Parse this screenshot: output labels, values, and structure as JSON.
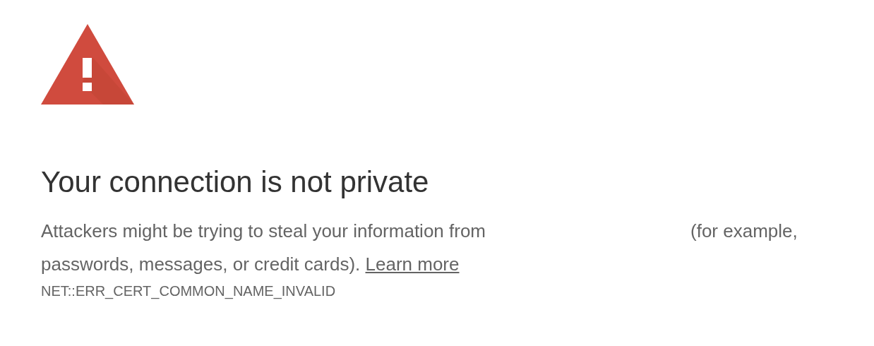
{
  "heading": "Your connection is not private",
  "message": {
    "before_gap": "Attackers might be trying to steal your information from",
    "after_gap": "(for example, passwords, messages, or credit cards).",
    "link": "Learn more"
  },
  "error_code": "NET::ERR_CERT_COMMON_NAME_INVALID"
}
